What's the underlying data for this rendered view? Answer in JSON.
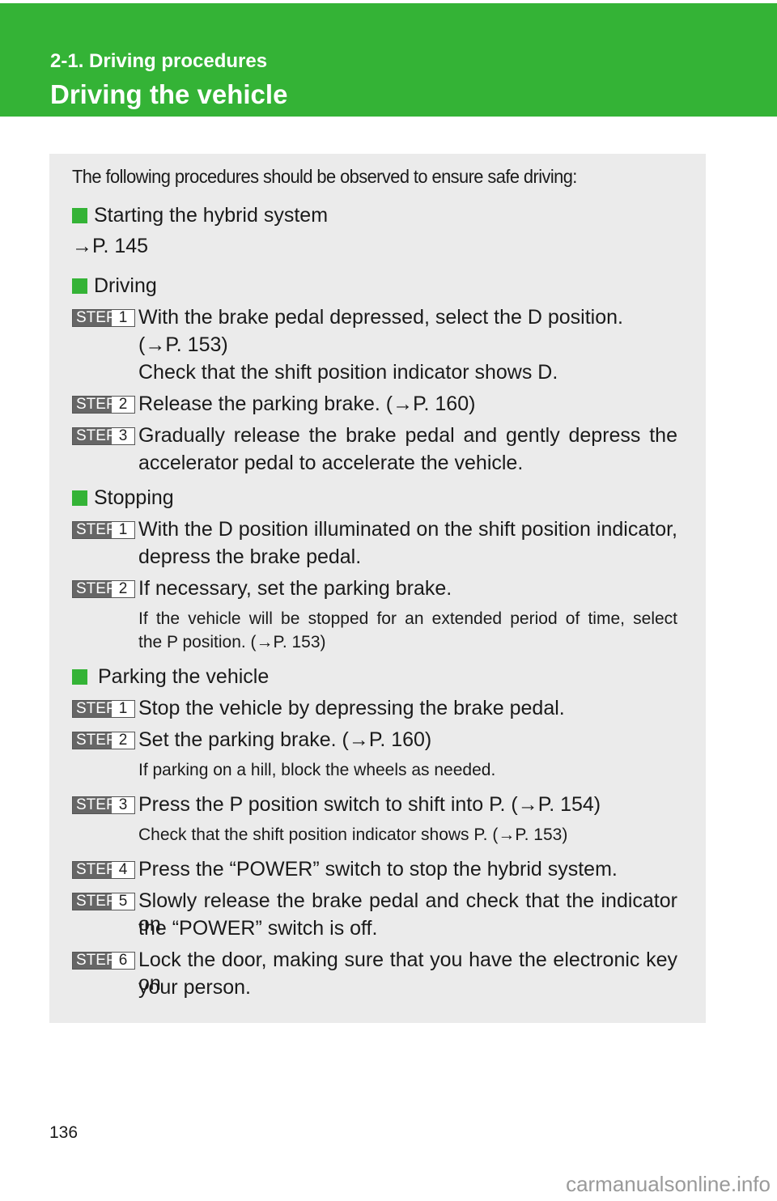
{
  "header": {
    "section": "2-1.  Driving procedures",
    "title": "Driving the vehicle",
    "color": "#34b336"
  },
  "intro": "The following procedures should be observed to ensure safe driving:",
  "sections": {
    "starting": {
      "heading": "Starting the hybrid system",
      "ref": "→P. 145"
    },
    "driving": {
      "heading": "Driving",
      "steps": [
        {
          "label": "STEP",
          "num": "1",
          "lines": [
            "With the brake pedal depressed, select the D position.",
            "(→P. 153)",
            "Check that the shift position indicator shows D."
          ]
        },
        {
          "label": "STEP",
          "num": "2",
          "lines": [
            "Release the parking brake. (→P. 160)"
          ]
        },
        {
          "label": "STEP",
          "num": "3",
          "lines": [
            "Gradually release the brake pedal and gently depress the",
            "accelerator pedal to accelerate the vehicle."
          ]
        }
      ]
    },
    "stopping": {
      "heading": "Stopping",
      "steps": [
        {
          "label": "STEP",
          "num": "1",
          "lines": [
            "With the D position illuminated on the shift position indicator,",
            "depress the brake pedal."
          ]
        },
        {
          "label": "STEP",
          "num": "2",
          "lines": [
            "If necessary, set the parking brake."
          ],
          "notes": [
            "If the vehicle will be stopped for an extended period of time, select",
            "the P position. (→P. 153)"
          ]
        }
      ]
    },
    "parking": {
      "heading": "Parking the vehicle",
      "steps": [
        {
          "label": "STEP",
          "num": "1",
          "lines": [
            "Stop the vehicle by depressing the brake pedal."
          ]
        },
        {
          "label": "STEP",
          "num": "2",
          "lines": [
            "Set the parking brake. (→P. 160)"
          ],
          "notes": [
            "If parking on a hill, block the wheels as needed."
          ]
        },
        {
          "label": "STEP",
          "num": "3",
          "lines": [
            "Press the P position switch to shift into P. (→P. 154)"
          ],
          "notes": [
            "Check that the shift position indicator shows P. (→P. 153)"
          ]
        },
        {
          "label": "STEP",
          "num": "4",
          "lines": [
            "Press the “POWER” switch to stop the hybrid system."
          ]
        },
        {
          "label": "STEP",
          "num": "5",
          "lines": [
            "Slowly release the brake pedal and check that the indicator on",
            "the “POWER” switch is off."
          ]
        },
        {
          "label": "STEP",
          "num": "6",
          "lines": [
            "Lock the door, making sure that you have the electronic key on",
            "your person."
          ]
        }
      ]
    }
  },
  "footer": {
    "page_number": "136",
    "watermark": "carmanualsonline.info"
  }
}
